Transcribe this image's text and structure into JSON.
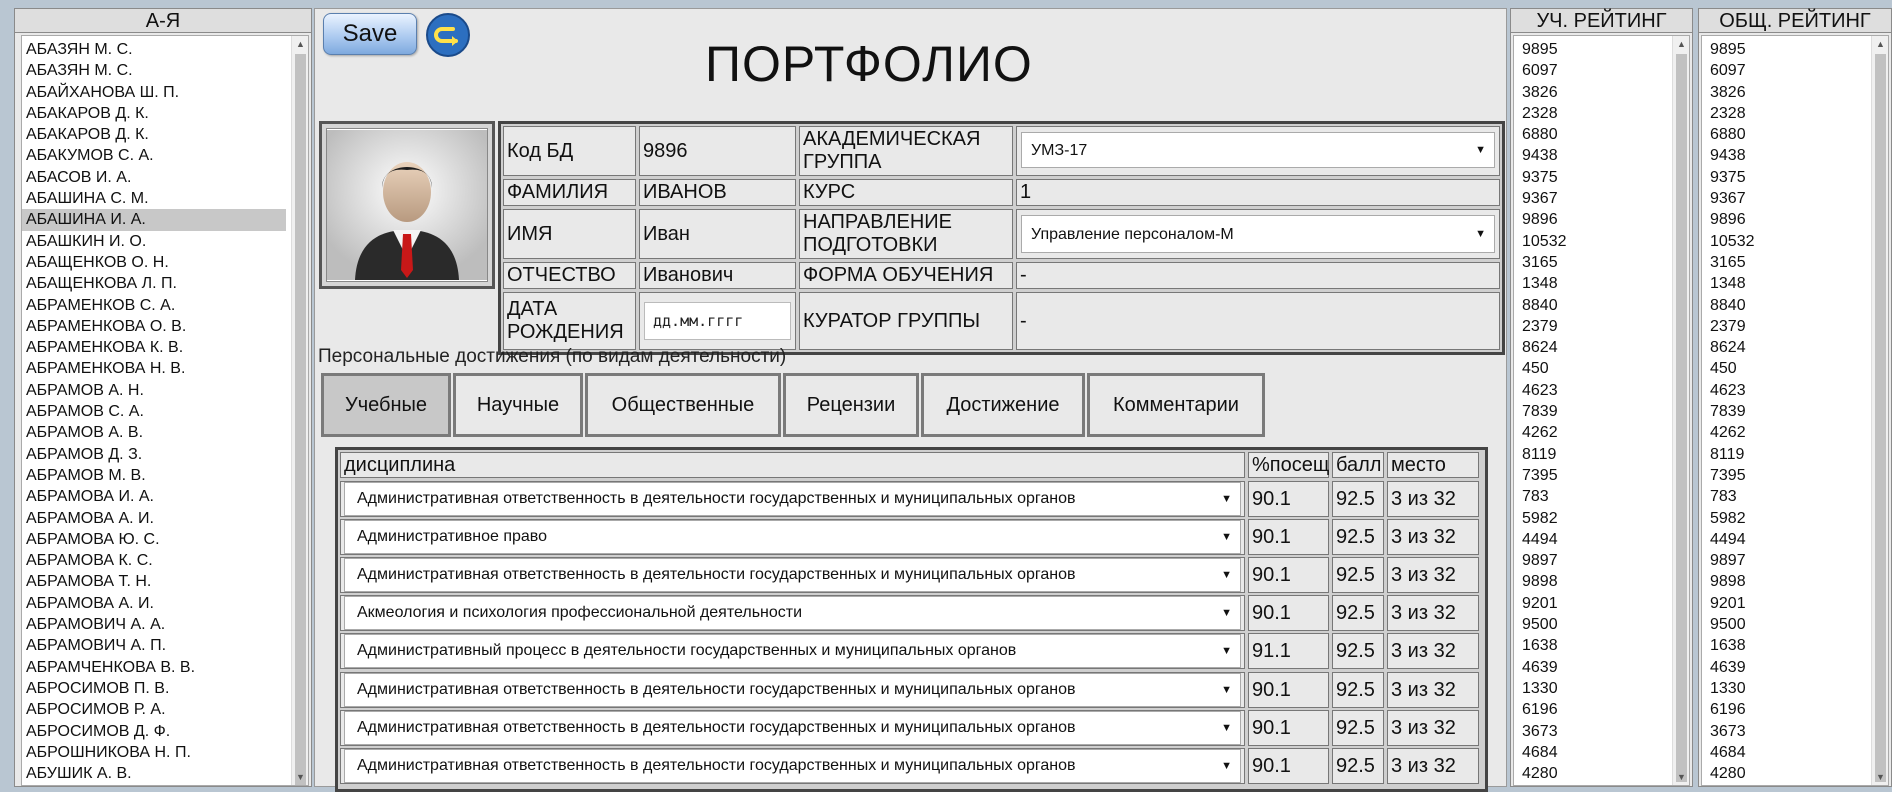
{
  "left_panel": {
    "header": "А-Я",
    "items": [
      "АБАЗЯН М. С.",
      "АБАЗЯН М. С.",
      "АБАЙХАНОВА Ш. П.",
      "АБАКАРОВ Д. К.",
      "АБАКАРОВ Д. К.",
      "АБАКУМОВ С. А.",
      "АБАСОВ И. А.",
      "АБАШИНА С. М.",
      "АБАШИНА И. А.",
      "АБАШКИН И. О.",
      "АБАЩЕНКОВ О. Н.",
      "АБАЩЕНКОВА Л. П.",
      "АБРАМЕНКОВ С. А.",
      "АБРАМЕНКОВА О. В.",
      "АБРАМЕНКОВА К. В.",
      "АБРАМЕНКОВА Н. В.",
      "АБРАМОВ А. Н.",
      "АБРАМОВ С. А.",
      "АБРАМОВ А. В.",
      "АБРАМОВ Д. З.",
      "АБРАМОВ М. В.",
      "АБРАМОВА И. А.",
      "АБРАМОВА А. И.",
      "АБРАМОВА Ю. С.",
      "АБРАМОВА К. С.",
      "АБРАМОВА Т. Н.",
      "АБРАМОВА А. И.",
      "АБРАМОВИЧ А. А.",
      "АБРАМОВИЧ А. П.",
      "АБРАМЧЕНКОВА В. В.",
      "АБРОСИМОВ П. В.",
      "АБРОСИМОВ Р. А.",
      "АБРОСИМОВ Д. Ф.",
      "АБРОШНИКОВА Н. П.",
      "АБУШИК А. В."
    ],
    "selected_index": 8,
    "scroll_fraction": 0.02
  },
  "toolbar": {
    "save_label": "Save"
  },
  "page_title": "ПОРТФОЛИО",
  "info": {
    "db_code_label": "Код БД",
    "db_code_value": "9896",
    "group_label": "АКАДЕМИЧЕСКАЯ ГРУППА",
    "group_value": "УМЗ-17",
    "surname_label": "ФАМИЛИЯ",
    "surname_value": "ИВАНОВ",
    "course_label": "КУРС",
    "course_value": "1",
    "name_label": "ИМЯ",
    "name_value": "Иван",
    "direction_label": "НАПРАВЛЕНИЕ ПОДГОТОВКИ",
    "direction_value": "Управление персоналом-М",
    "patronymic_label": "ОТЧЕСТВО",
    "patronymic_value": "Иванович",
    "form_label": "ФОРМА ОБУЧЕНИЯ",
    "form_value": "-",
    "birth_label": "ДАТА РОЖДЕНИЯ",
    "birth_placeholder": "дд.мм.гггг",
    "curator_label": "КУРАТОР ГРУППЫ",
    "curator_value": "-"
  },
  "section_label": "Персональные достижения (по видам деятельности)",
  "tabs": [
    "Учебные",
    "Научные",
    "Общественные",
    "Рецензии",
    "Достижение",
    "Комментарии"
  ],
  "active_tab": 0,
  "grid": {
    "headers": [
      "дисциплина",
      "%посещ",
      "балл",
      "место"
    ],
    "rows": [
      {
        "discipline": "Административная ответственность в деятельности государственных и муниципальных органов",
        "attendance": "90.1",
        "score": "92.5",
        "place": "3 из 32"
      },
      {
        "discipline": "Административное право",
        "attendance": "90.1",
        "score": "92.5",
        "place": "3 из 32"
      },
      {
        "discipline": "Административная ответственность в деятельности государственных и муниципальных органов",
        "attendance": "90.1",
        "score": "92.5",
        "place": "3 из 32"
      },
      {
        "discipline": "Акмеология и психология профессиональной деятельности",
        "attendance": "90.1",
        "score": "92.5",
        "place": "3 из 32"
      },
      {
        "discipline": "Административный процесс в деятельности государственных и муниципальных органов",
        "attendance": "91.1",
        "score": "92.5",
        "place": "3 из 32"
      },
      {
        "discipline": "Административная ответственность в деятельности государственных и муниципальных органов",
        "attendance": "90.1",
        "score": "92.5",
        "place": "3 из 32"
      },
      {
        "discipline": "Административная ответственность в деятельности государственных и муниципальных органов",
        "attendance": "90.1",
        "score": "92.5",
        "place": "3 из 32"
      },
      {
        "discipline": "Административная ответственность в деятельности государственных и муниципальных органов",
        "attendance": "90.1",
        "score": "92.5",
        "place": "3 из 32"
      }
    ]
  },
  "rating_study": {
    "header": "УЧ. РЕЙТИНГ",
    "values": [
      "9895",
      "6097",
      "3826",
      "2328",
      "6880",
      "9438",
      "9375",
      "9367",
      "9896",
      "10532",
      "3165",
      "1348",
      "8840",
      "2379",
      "8624",
      "450",
      "4623",
      "7839",
      "4262",
      "8119",
      "7395",
      "783",
      "5982",
      "4494",
      "9897",
      "9898",
      "9201",
      "9500",
      "1638",
      "4639",
      "1330",
      "6196",
      "3673",
      "4684",
      "4280"
    ]
  },
  "rating_total": {
    "header": "ОБЩ. РЕЙТИНГ",
    "values": [
      "9895",
      "6097",
      "3826",
      "2328",
      "6880",
      "9438",
      "9375",
      "9367",
      "9896",
      "10532",
      "3165",
      "1348",
      "8840",
      "2379",
      "8624",
      "450",
      "4623",
      "7839",
      "4262",
      "8119",
      "7395",
      "783",
      "5982",
      "4494",
      "9897",
      "9898",
      "9201",
      "9500",
      "1638",
      "4639",
      "1330",
      "6196",
      "3673",
      "4684",
      "4280"
    ]
  },
  "icons": {
    "undo": "undo-arrow-icon",
    "avatar": "user-avatar-icon",
    "dropdown": "caret-down-icon"
  },
  "colors": {
    "save_button": "#a9c8ef",
    "undo_button": "#2c6fc0",
    "active_tab": "#c8c8c8",
    "page_bg": "#e9e9e9"
  }
}
